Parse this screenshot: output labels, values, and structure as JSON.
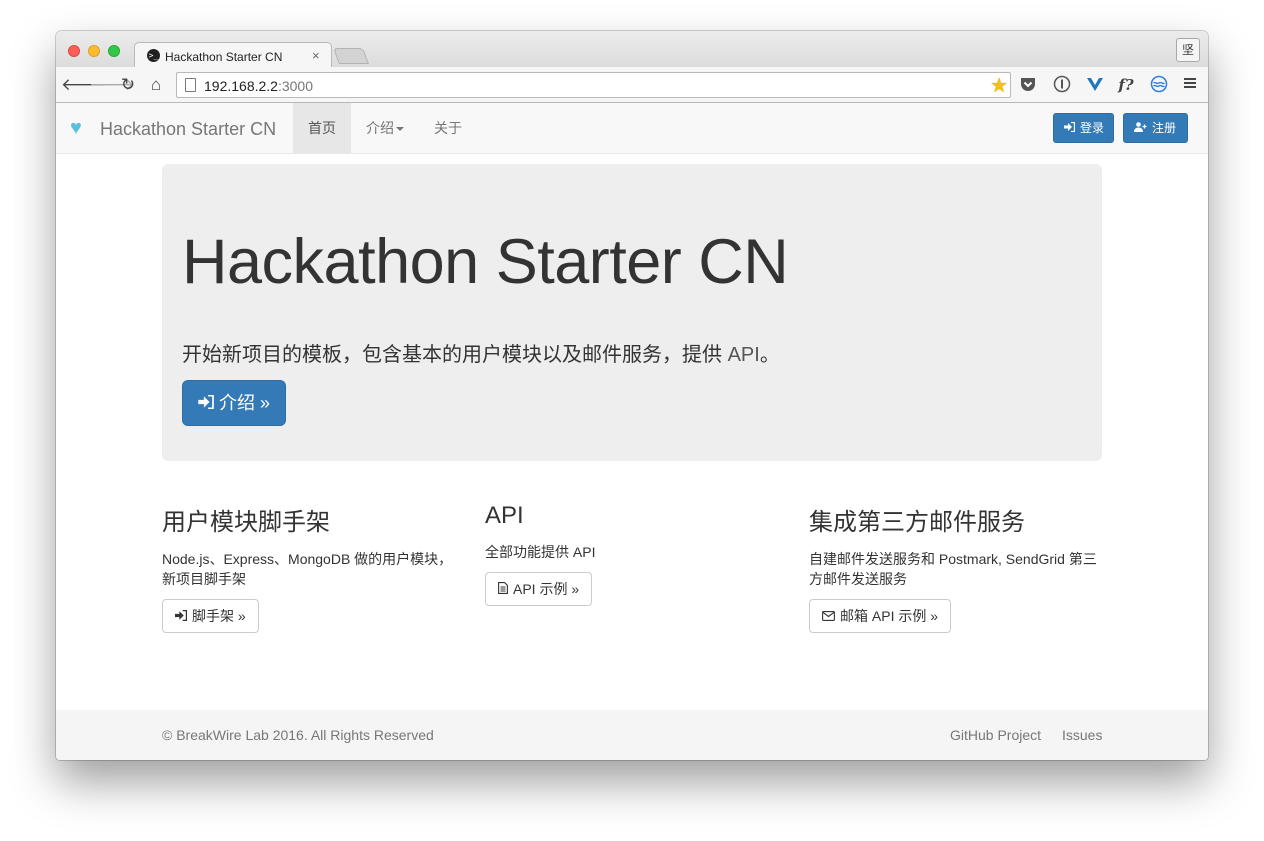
{
  "browser": {
    "tab_title": "Hackathon Starter CN",
    "tab_favicon": ">_",
    "close_glyph": "×",
    "profile_label": "坚",
    "url_host": "192.168.2.2",
    "url_port": ":3000",
    "icons": [
      "back-icon",
      "forward-icon",
      "reload-icon",
      "home-icon",
      "page-icon",
      "star-icon",
      "pocket-icon",
      "onepassword-icon",
      "vue-devtools-icon",
      "fq-icon",
      "wave-icon",
      "menu-icon"
    ]
  },
  "navbar": {
    "brand": "Hackathon Starter CN",
    "items": [
      {
        "label": "首页",
        "active": true
      },
      {
        "label": "介绍",
        "dropdown": true
      },
      {
        "label": "关于"
      }
    ],
    "login_label": "登录",
    "signup_label": "注册"
  },
  "jumbotron": {
    "title": "Hackathon Starter CN",
    "lead": "开始新项目的模板，包含基本的用户模块以及邮件服务，提供 ",
    "lead_api": "API",
    "lead_end": "。",
    "button_label": "介绍 »"
  },
  "columns": [
    {
      "heading": "用户模块脚手架",
      "text": "Node.js、Express、MongoDB 做的用户模块，新项目脚手架",
      "button": "脚手架 »"
    },
    {
      "heading": "API",
      "text": "全部功能提供 API",
      "button": "API 示例 »"
    },
    {
      "heading": "集成第三方邮件服务",
      "text": "自建邮件发送服务和 Postmark, SendGrid 第三方邮件发送服务",
      "button": "邮箱 API 示例 »"
    }
  ],
  "footer": {
    "copyright": "© BreakWire Lab 2016. All Rights Reserved",
    "links": [
      "GitHub Project",
      "Issues"
    ]
  },
  "colors": {
    "primary": "#337ab7",
    "brand_icon": "#5bc0de",
    "jumbotron_bg": "#eeeeee"
  }
}
